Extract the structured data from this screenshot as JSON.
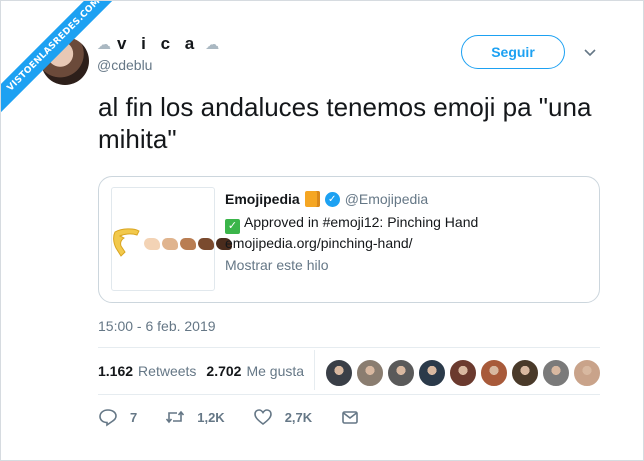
{
  "watermark": {
    "text": "VISTOENLASREDES.COM"
  },
  "author": {
    "display_name": "v i c a",
    "handle": "@cdeblu",
    "name_decoration_icon": "cloud-icon"
  },
  "follow_button": {
    "label": "Seguir"
  },
  "tweet": {
    "text": "al fin los andaluces tenemos emoji pa \"una mihita\""
  },
  "quoted_tweet": {
    "name": "Emojipedia",
    "handle": "@Emojipedia",
    "line1": "Approved in #emoji12: Pinching Hand",
    "line2": "emojipedia.org/pinching-hand/",
    "show_thread": "Mostrar este hilo",
    "hand_colors": [
      "#f2c94c",
      "#f3d3b5",
      "#e0b48e",
      "#b97d52",
      "#7a4a2e",
      "#4a2c1d"
    ]
  },
  "timestamp": "15:00 - 6 feb. 2019",
  "stats": {
    "retweets_count": "1.162",
    "retweets_label": "Retweets",
    "likes_count": "2.702",
    "likes_label": "Me gusta"
  },
  "likers": {
    "colors": [
      "#3a3f47",
      "#8a7d70",
      "#5a5a5a",
      "#2b3a4a",
      "#6b3a2e",
      "#a85a3a",
      "#4a3a2a",
      "#7a7a7a",
      "#c9a38a"
    ]
  },
  "actions": {
    "replies": "7",
    "retweets": "1,2K",
    "likes": "2,7K"
  },
  "colors": {
    "accent": "#1da1f2",
    "secondary_text": "#657786",
    "border": "#e6ecf0"
  }
}
